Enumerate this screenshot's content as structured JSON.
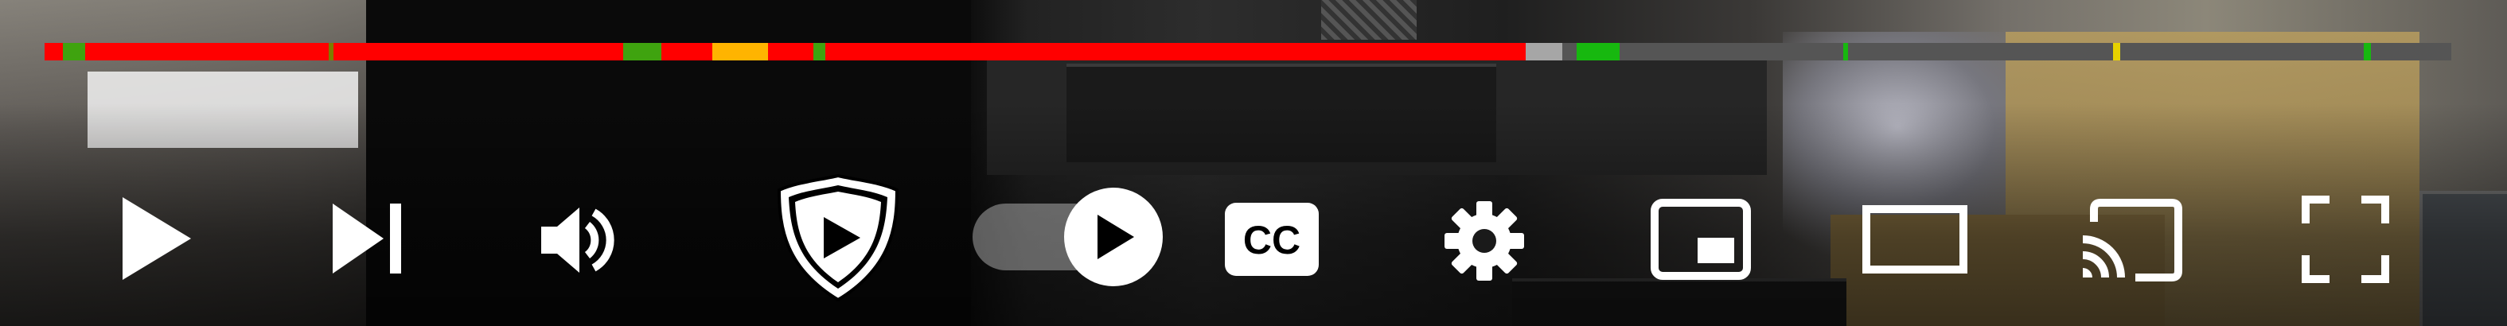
{
  "player": {
    "scrubber": {
      "played_fraction": 0.615,
      "buffered_fraction": 0.634,
      "segments": [
        {
          "start": 0.0,
          "end": 0.0075,
          "color": "#ff0000"
        },
        {
          "start": 0.0075,
          "end": 0.0168,
          "color": "#3fa30f"
        },
        {
          "start": 0.0168,
          "end": 0.118,
          "color": "#ff0000"
        },
        {
          "start": 0.118,
          "end": 0.12,
          "color": "#7d7d00"
        },
        {
          "start": 0.12,
          "end": 0.2405,
          "color": "#ff0000"
        },
        {
          "start": 0.2405,
          "end": 0.2563,
          "color": "#3fa30f"
        },
        {
          "start": 0.2563,
          "end": 0.2775,
          "color": "#ff0000"
        },
        {
          "start": 0.2775,
          "end": 0.285,
          "color": "#ffb400"
        },
        {
          "start": 0.285,
          "end": 0.3005,
          "color": "#ffb400"
        },
        {
          "start": 0.3005,
          "end": 0.3195,
          "color": "#ff0000"
        },
        {
          "start": 0.3195,
          "end": 0.3245,
          "color": "#3fa30f"
        },
        {
          "start": 0.3245,
          "end": 0.6155,
          "color": "#ff0000"
        },
        {
          "start": 0.6155,
          "end": 0.6305,
          "color": "#a6a6a6"
        },
        {
          "start": 0.6365,
          "end": 0.6545,
          "color": "#17b80f"
        },
        {
          "start": 0.7475,
          "end": 0.7495,
          "color": "#17b80f"
        },
        {
          "start": 0.8595,
          "end": 0.8625,
          "color": "#e6d200"
        },
        {
          "start": 0.9635,
          "end": 0.9665,
          "color": "#17b80f"
        }
      ]
    },
    "toggle": {
      "state": "on"
    },
    "icons": {
      "play": "play-icon",
      "next": "next-icon",
      "volume": "volume-icon",
      "shield": "sponsorblock-shield-icon",
      "autoplay": "autoplay-toggle-icon",
      "captions": "captions-icon",
      "settings": "gear-icon",
      "miniplayer": "miniplayer-icon",
      "theater": "theater-mode-icon",
      "cast": "cast-icon",
      "fullscreen": "fullscreen-icon"
    },
    "captions_label": "CC",
    "colors": {
      "icon": "#ffffff",
      "played": "#ff0000",
      "buffer": "#a6a6a6",
      "track": "#555555"
    }
  }
}
